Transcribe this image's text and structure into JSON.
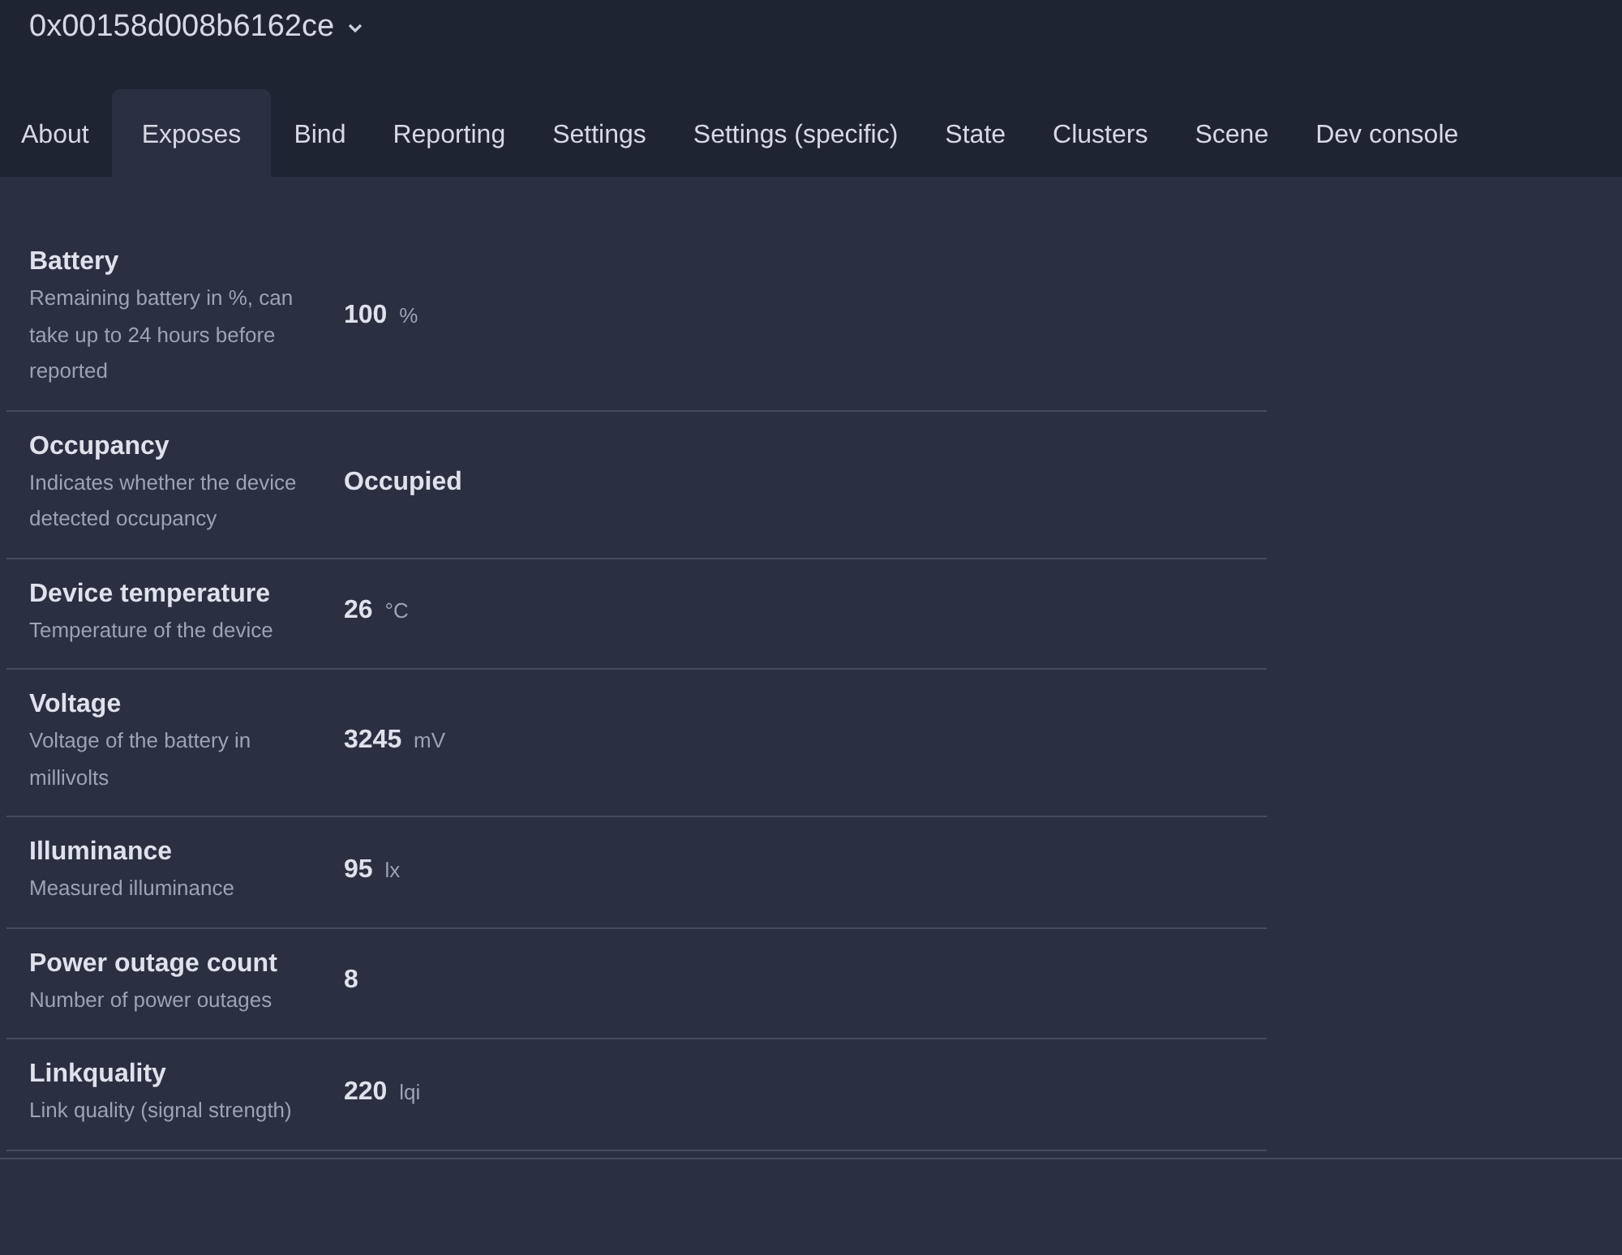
{
  "device": {
    "title": "0x00158d008b6162ce"
  },
  "tabs": [
    {
      "label": "About",
      "selected": false
    },
    {
      "label": "Exposes",
      "selected": true
    },
    {
      "label": "Bind",
      "selected": false
    },
    {
      "label": "Reporting",
      "selected": false
    },
    {
      "label": "Settings",
      "selected": false
    },
    {
      "label": "Settings (specific)",
      "selected": false
    },
    {
      "label": "State",
      "selected": false
    },
    {
      "label": "Clusters",
      "selected": false
    },
    {
      "label": "Scene",
      "selected": false
    },
    {
      "label": "Dev console",
      "selected": false
    }
  ],
  "exposes": [
    {
      "name": "Battery",
      "description": "Remaining battery in %, can take up to 24 hours before reported",
      "value": "100",
      "unit": "%"
    },
    {
      "name": "Occupancy",
      "description": "Indicates whether the device detected occupancy",
      "value": "Occupied"
    },
    {
      "name": "Device temperature",
      "description": "Temperature of the device",
      "value": "26",
      "unit": "°C"
    },
    {
      "name": "Voltage",
      "description": "Voltage of the battery in millivolts",
      "value": "3245",
      "unit": "mV"
    },
    {
      "name": "Illuminance",
      "description": "Measured illuminance",
      "value": "95",
      "unit": "lx"
    },
    {
      "name": "Power outage count",
      "description": "Number of power outages",
      "value": "8"
    },
    {
      "name": "Linkquality",
      "description": "Link quality (signal strength)",
      "value": "220",
      "unit": "lqi"
    }
  ]
}
